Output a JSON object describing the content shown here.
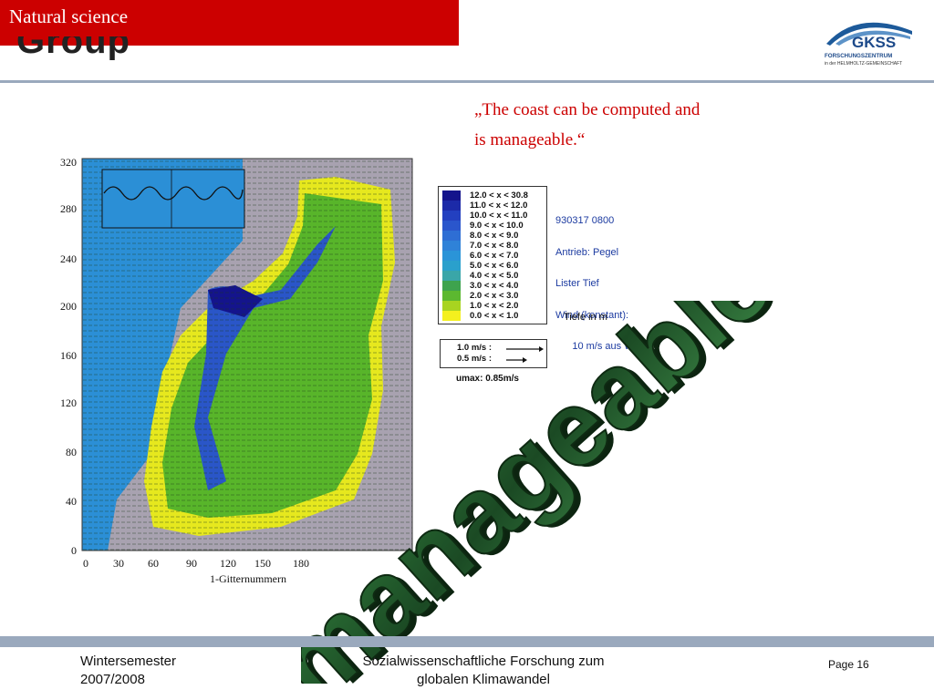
{
  "banner": {
    "title": "Natural science",
    "ghost_title": "Group"
  },
  "logo": {
    "name": "GKSS",
    "line1": "FORSCHUNGSZENTRUM",
    "line2": "in der HELMHOLTZ-GEMEINSCHAFT"
  },
  "quote": {
    "line1": "„The coast can be computed and",
    "line2": "is manageable.“"
  },
  "figure": {
    "y_ticks": [
      "320",
      "280",
      "240",
      "200",
      "160",
      "120",
      "80",
      "40",
      "0"
    ],
    "x_ticks": [
      "0",
      "30",
      "60",
      "90",
      "120",
      "150",
      "180"
    ],
    "x_label": "1-Gitternummern"
  },
  "legend": {
    "rows": [
      {
        "text": "12.0 <  x < 30.8",
        "color": "#14148c"
      },
      {
        "text": "11.0 <  x < 12.0",
        "color": "#1c2aa8"
      },
      {
        "text": "10.0 <  x < 11.0",
        "color": "#2340c0"
      },
      {
        "text": "9.0 <  x < 10.0",
        "color": "#2a56cc"
      },
      {
        "text": "8.0 <  x <   9.0",
        "color": "#2e6ed4"
      },
      {
        "text": "7.0 <  x <   8.0",
        "color": "#2f82d8"
      },
      {
        "text": "6.0 <  x <   7.0",
        "color": "#2a94d8"
      },
      {
        "text": "5.0 <  x <   6.0",
        "color": "#2aa0cc"
      },
      {
        "text": "4.0 <  x <   5.0",
        "color": "#3aa6a8"
      },
      {
        "text": "3.0 <  x <   4.0",
        "color": "#3ea34e"
      },
      {
        "text": "2.0 <  x <   3.0",
        "color": "#5cb830"
      },
      {
        "text": "1.0 <  x <   2.0",
        "color": "#a8d420"
      },
      {
        "text": "0.0 <  x <   1.0",
        "color": "#f4f01e"
      }
    ]
  },
  "info": {
    "lines": [
      "930317 0800",
      "Antrieb: Pegel",
      "Lister Tief",
      "Wind (konstant):",
      "      10 m/s aus W"
    ],
    "depth_label": "Tiefe in m"
  },
  "velocity": {
    "row1": "1.0 m/s :",
    "row2": "0.5 m/s :",
    "umax": "umax: 0.85m/s"
  },
  "wordart": {
    "text": "manageable"
  },
  "footer": {
    "left_line1": "Wintersemester",
    "left_line2": "2007/2008",
    "center_line1": "Sozialwissenschaftliche Forschung zum",
    "center_line2": "globalen Klimawandel",
    "page": "Page 16"
  },
  "colors": {
    "banner": "#cc0000",
    "quote": "#cc0000",
    "rule": "#9aa9bd",
    "wordart": "#1f5a2a"
  }
}
